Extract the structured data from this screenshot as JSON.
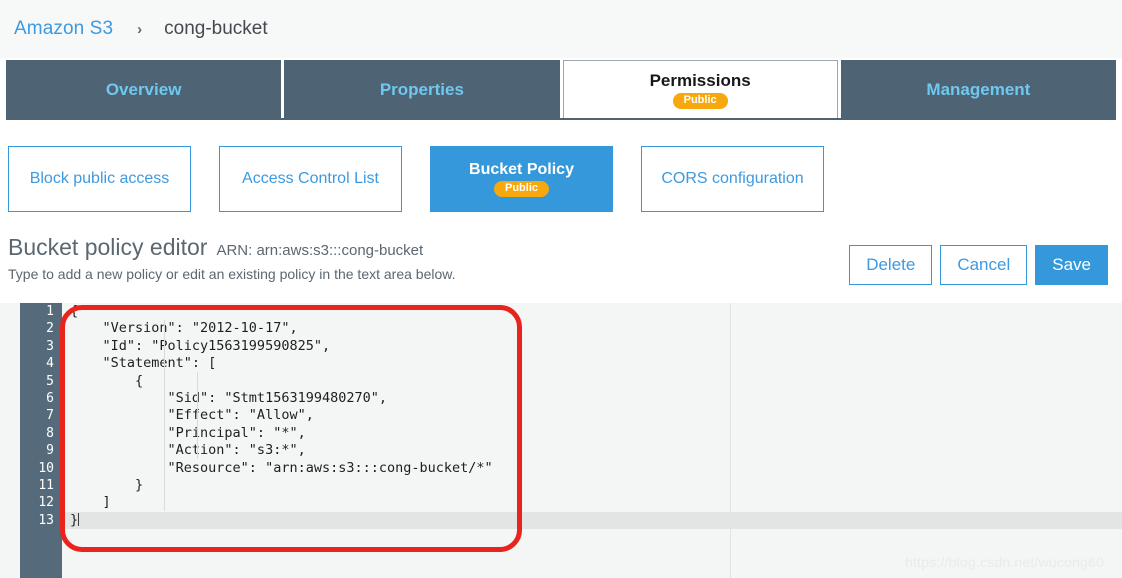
{
  "breadcrumb": {
    "root_label": "Amazon S3",
    "separator": "›",
    "current_label": "cong-bucket"
  },
  "tabs": [
    {
      "label": "Overview",
      "active": false,
      "badge": null
    },
    {
      "label": "Properties",
      "active": false,
      "badge": null
    },
    {
      "label": "Permissions",
      "active": true,
      "badge": "Public"
    },
    {
      "label": "Management",
      "active": false,
      "badge": null
    }
  ],
  "subtabs": [
    {
      "label": "Block public access",
      "selected": false,
      "badge": null
    },
    {
      "label": "Access Control List",
      "selected": false,
      "badge": null
    },
    {
      "label": "Bucket Policy",
      "selected": true,
      "badge": "Public"
    },
    {
      "label": "CORS configuration",
      "selected": false,
      "badge": null
    }
  ],
  "editor_header": {
    "title": "Bucket policy editor",
    "arn": "ARN: arn:aws:s3:::cong-bucket",
    "subtitle": "Type to add a new policy or edit an existing policy in the text area below."
  },
  "actions": {
    "delete_label": "Delete",
    "cancel_label": "Cancel",
    "save_label": "Save"
  },
  "code_editor": {
    "line_numbers": [
      "1",
      "2",
      "3",
      "4",
      "5",
      "6",
      "7",
      "8",
      "9",
      "10",
      "11",
      "12",
      "13"
    ],
    "lines": [
      "{",
      "    \"Version\": \"2012-10-17\",",
      "    \"Id\": \"Policy1563199590825\",",
      "    \"Statement\": [",
      "        {",
      "            \"Sid\": \"Stmt1563199480270\",",
      "            \"Effect\": \"Allow\",",
      "            \"Principal\": \"*\",",
      "            \"Action\": \"s3:*\",",
      "            \"Resource\": \"arn:aws:s3:::cong-bucket/*\"",
      "        }",
      "    ]",
      "}"
    ],
    "active_line_index": 12
  },
  "watermark": {
    "text": "https://blog.csdn.net/wucong60"
  },
  "colors": {
    "accent_blue": "#3498db",
    "tab_slate": "#4e6373",
    "badge_orange": "#f7a80d",
    "annotation_red": "#e8241c",
    "editor_bg": "#f4f5f5"
  }
}
